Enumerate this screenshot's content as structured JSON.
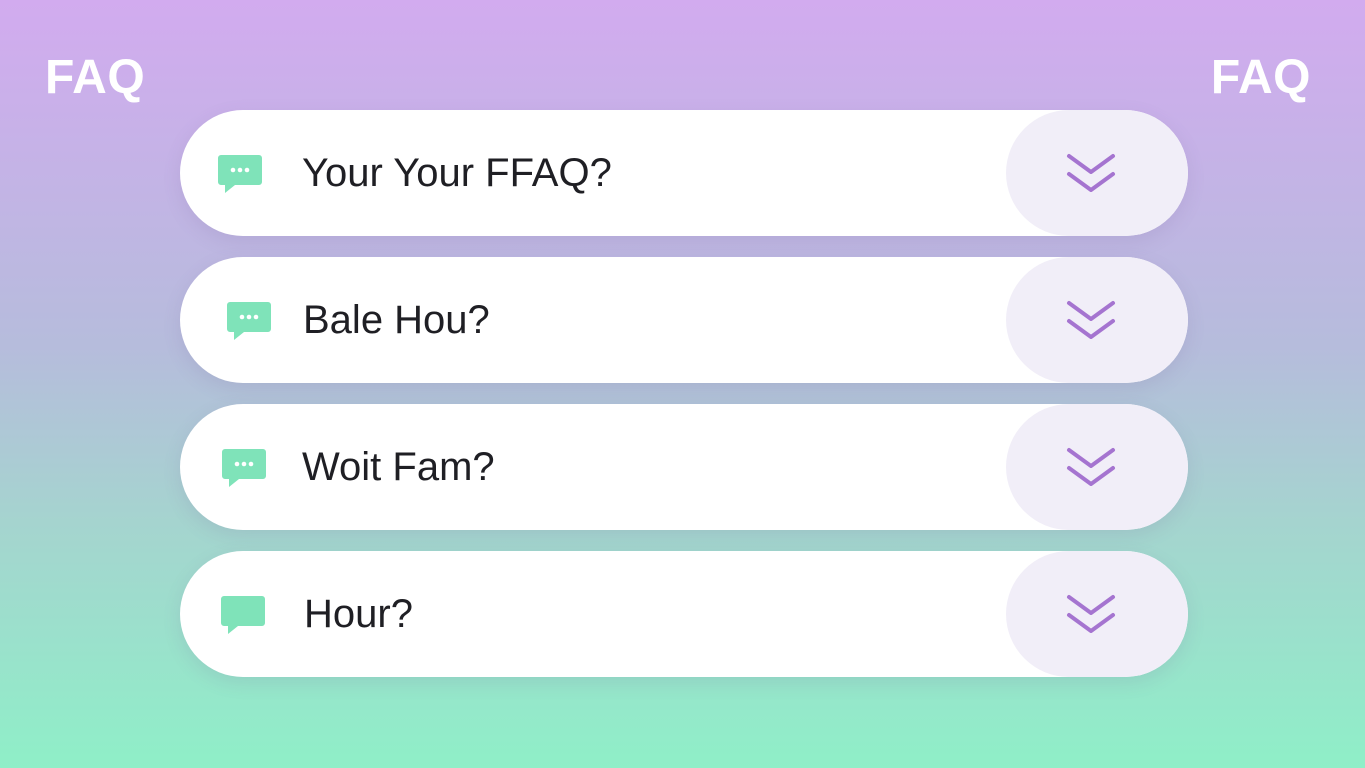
{
  "header": {
    "title_left": "FAQ",
    "title_right": "FAQ"
  },
  "faq": {
    "items": [
      {
        "question": "Your Your FFAQ?",
        "icon": "chat-bubble-dots-icon"
      },
      {
        "question": "Bale Hou?",
        "icon": "chat-bubble-dots-icon"
      },
      {
        "question": "Woit Fam?",
        "icon": "chat-bubble-dots-icon"
      },
      {
        "question": "Hour?",
        "icon": "chat-bubble-icon"
      }
    ],
    "toggle_icon": "double-chevron-down-icon"
  },
  "colors": {
    "accent_green": "#7fe3b9",
    "accent_purple": "#a574d0",
    "toggle_background": "#f1eef8",
    "card_background": "#ffffff"
  }
}
